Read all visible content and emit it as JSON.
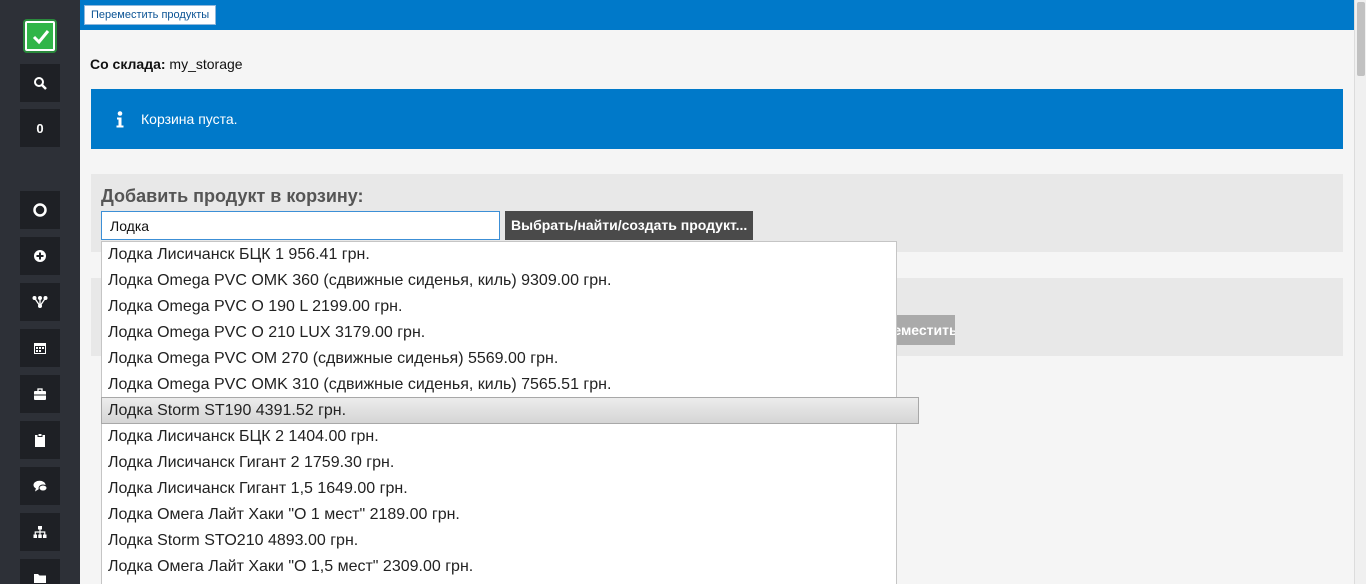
{
  "topbar": {
    "move_tab_label": "Переместить продукты"
  },
  "sidebar": {
    "counter": "0",
    "icons": [
      "search-icon",
      "life-ring-icon",
      "plus-circle-icon",
      "sitemap-icon",
      "calendar-icon",
      "briefcase-icon",
      "clipboard-icon",
      "comments-icon",
      "org-chart-icon",
      "folder-icon"
    ]
  },
  "main": {
    "from_storage_label": "Со склада:",
    "from_storage_value": "my_storage",
    "alert_text": "Корзина пуста.",
    "add_title": "Добавить продукт в корзину:",
    "search_value": "Лодка ",
    "pick_button": "Выбрать/найти/создать продукт...",
    "move_button": "ереместить"
  },
  "dropdown": {
    "items": [
      "Лодка Лисичанск БЦК 1 956.41 грн.",
      "Лодка Omega PVC OMK 360 (сдвижные сиденья, киль) 9309.00 грн.",
      "Лодка Omega PVC O 190 L 2199.00 грн.",
      "Лодка Omega PVC O 210 LUX 3179.00 грн.",
      "Лодка Omega PVC OM 270 (сдвижные сиденья) 5569.00 грн.",
      "Лодка Omega PVC OMK 310 (сдвижные сиденья, киль) 7565.51 грн.",
      "Лодка Storm ST190 4391.52 грн.",
      "Лодка Лисичанск БЦК 2 1404.00 грн.",
      "Лодка Лисичанск Гигант 2 1759.30 грн.",
      "Лодка Лисичанск Гигант 1,5 1649.00 грн.",
      "Лодка Омега Лайт Хаки \"О 1 мест\" 2189.00 грн.",
      "Лодка Storm STO210 4893.00 грн.",
      "Лодка Омега Лайт Хаки \"О 1,5 мест\" 2309.00 грн."
    ],
    "active_index": 6
  },
  "colors": {
    "accent": "#0079c9",
    "sidebar": "#2d3037",
    "logo": "#30b548"
  }
}
